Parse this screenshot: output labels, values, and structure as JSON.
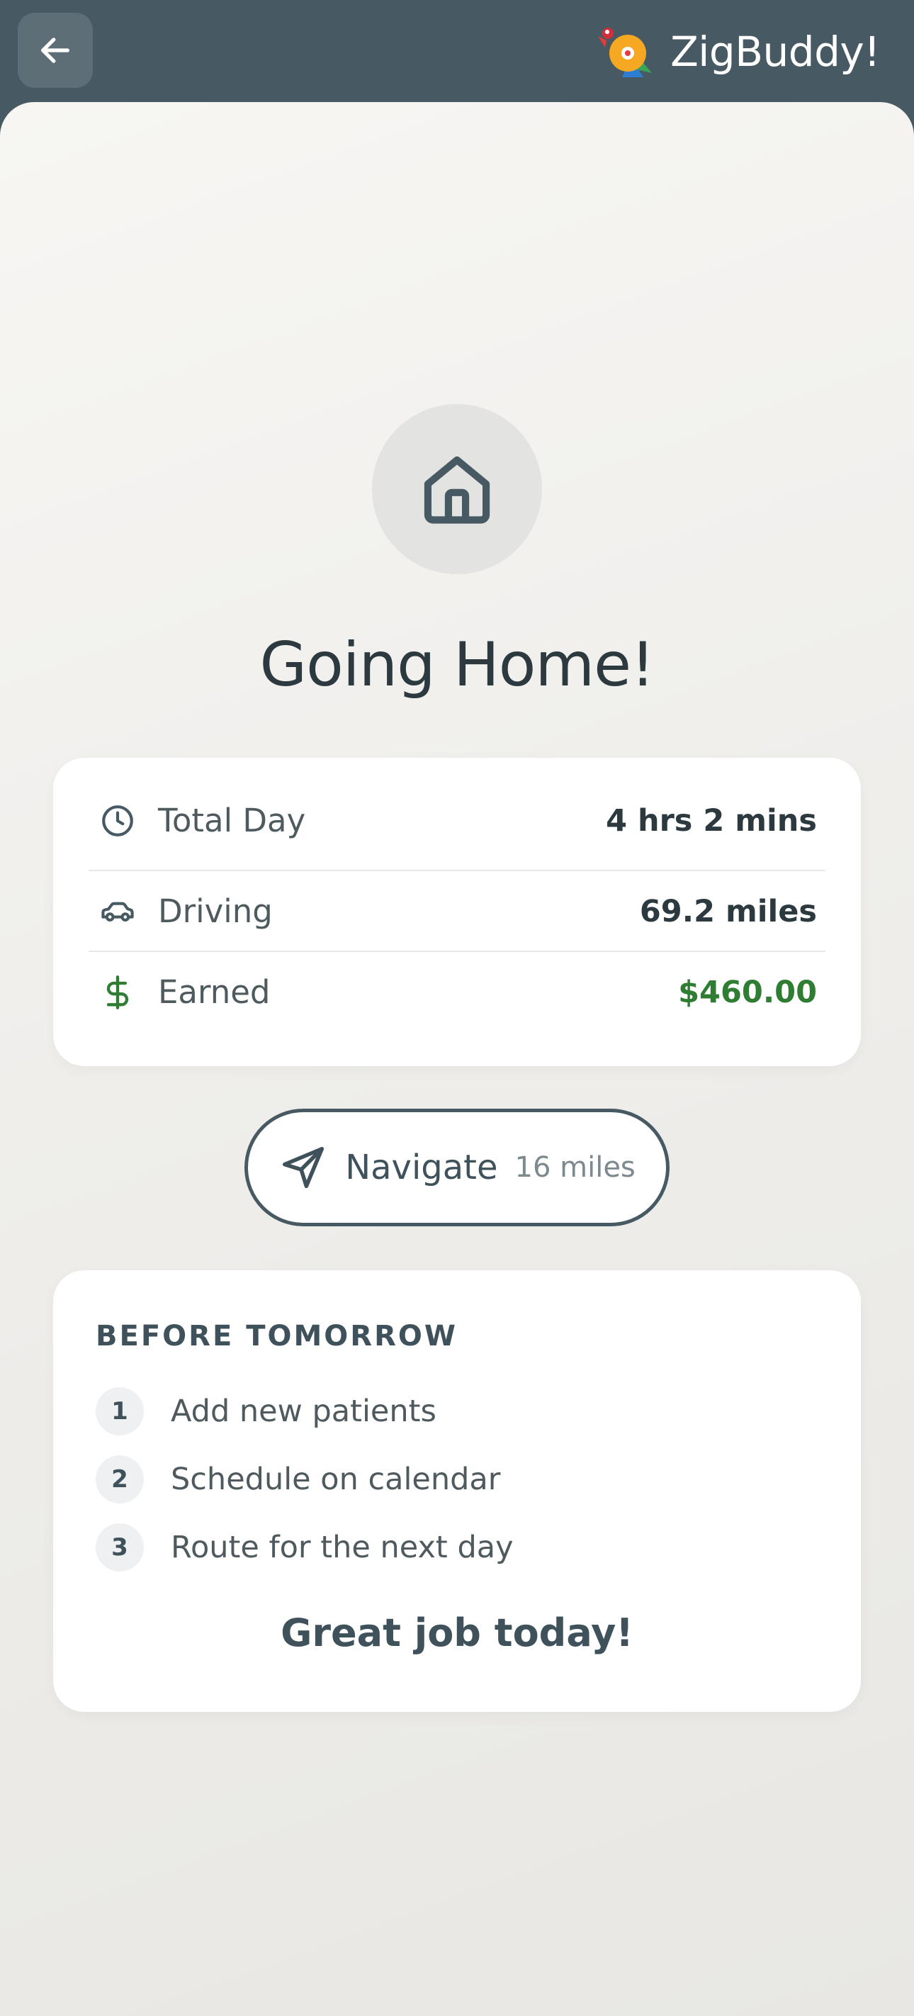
{
  "header": {
    "brand_name": "ZigBuddy!",
    "icons": {
      "back": "arrow-left-icon",
      "logo": "zigbuddy-bird-logo"
    }
  },
  "hero": {
    "icon": "home-icon",
    "title": "Going Home!"
  },
  "stats": [
    {
      "icon": "clock-icon",
      "label": "Total Day",
      "value": "4 hrs 2 mins"
    },
    {
      "icon": "car-icon",
      "label": "Driving",
      "value": "69.2 miles"
    },
    {
      "icon": "dollar-icon",
      "label": "Earned",
      "value": "$460.00"
    }
  ],
  "navigate": {
    "icon": "navigation-arrow-icon",
    "label": "Navigate",
    "distance": "16 miles"
  },
  "before_tomorrow": {
    "heading": "BEFORE TOMORROW",
    "tasks": [
      {
        "num": "1",
        "label": "Add new patients"
      },
      {
        "num": "2",
        "label": "Schedule on calendar"
      },
      {
        "num": "3",
        "label": "Route for the next day"
      }
    ],
    "footer": "Great job today!"
  },
  "colors": {
    "header_bg": "#475a63",
    "earned_green": "#2e7d32",
    "primary_text": "#2c3a40"
  }
}
